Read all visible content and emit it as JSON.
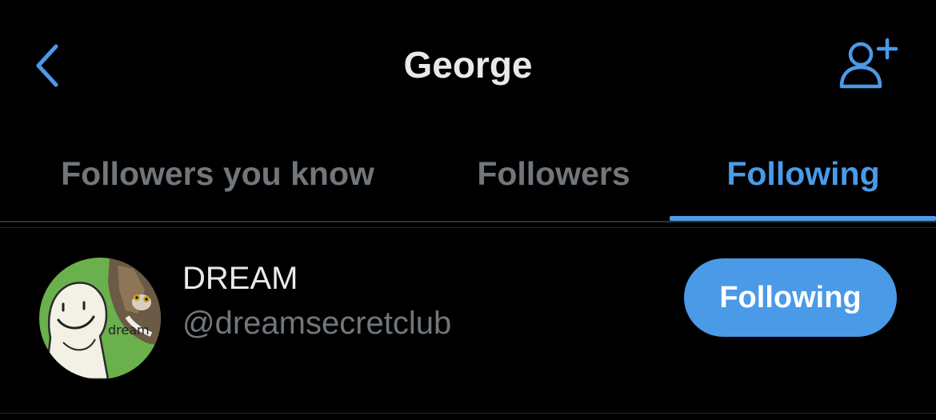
{
  "header": {
    "title": "George",
    "back_icon": "chevron-left-icon",
    "add_icon": "add-user-icon"
  },
  "tabs": [
    {
      "label": "Followers you know",
      "active": false
    },
    {
      "label": "Followers",
      "active": false
    },
    {
      "label": "Following",
      "active": true
    }
  ],
  "users": [
    {
      "display_name": "DREAM",
      "handle": "@dreamsecretclub",
      "avatar_text": "dream",
      "button_label": "Following"
    }
  ],
  "colors": {
    "background": "#000000",
    "accent": "#4a9ae8",
    "primary_text": "#e7e9ea",
    "secondary_text": "#71767b",
    "avatar_green": "#6ab04c"
  }
}
